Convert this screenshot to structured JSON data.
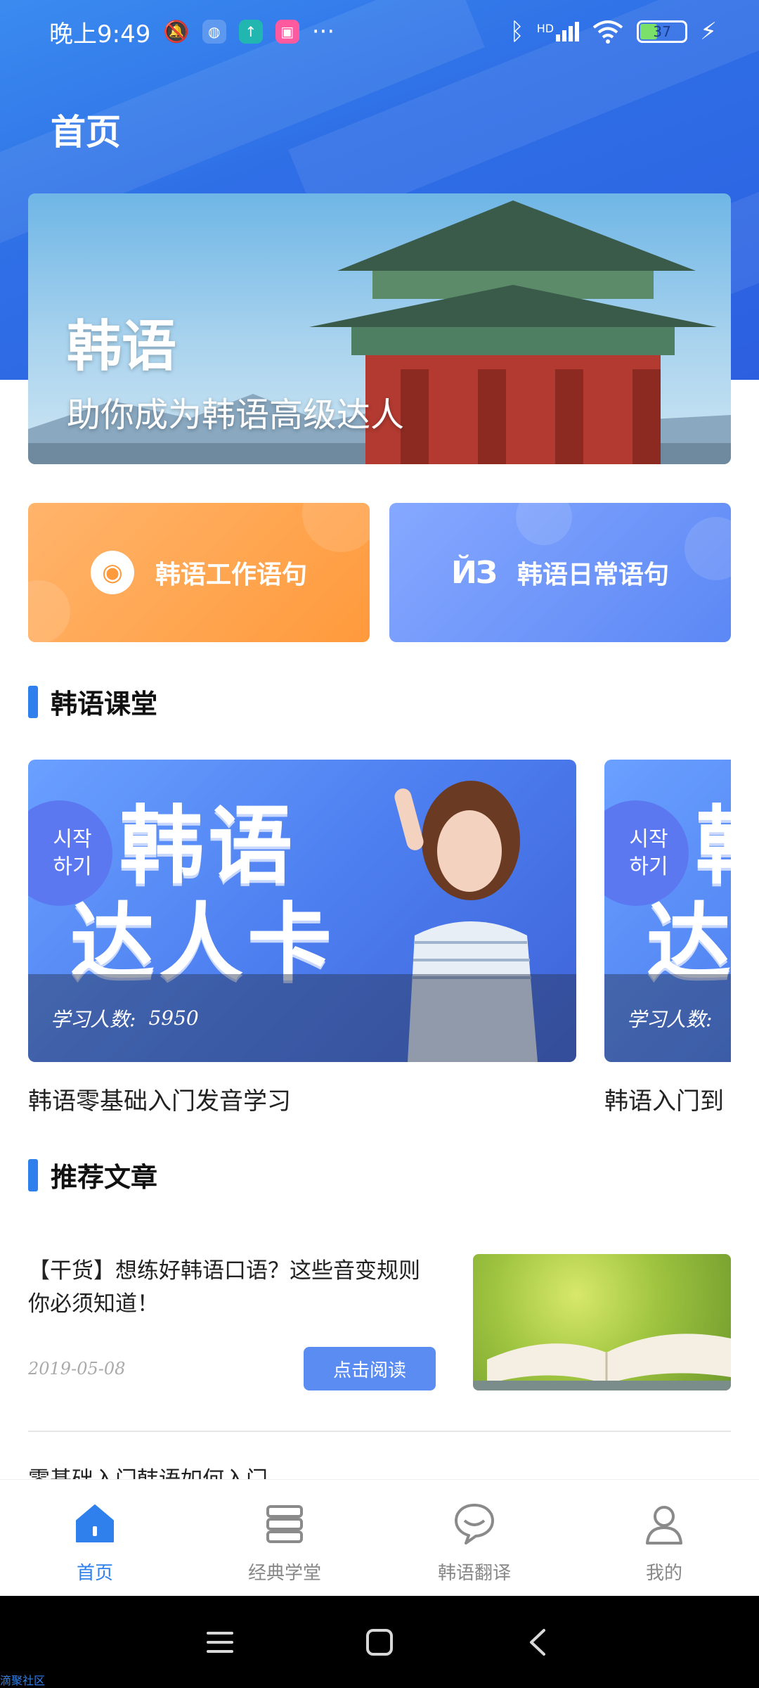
{
  "status_bar": {
    "time": "晚上9:49",
    "battery": "37",
    "more": "···",
    "network": "HD"
  },
  "header": {
    "title": "首页"
  },
  "banner": {
    "headline": "韩语",
    "subline": "助你成为韩语高级达人"
  },
  "quick_links": [
    {
      "label": "韩语工作语句",
      "icon": "lifebuoy-icon"
    },
    {
      "label": "韩语日常语句",
      "icon": "en-icon",
      "icon_text": "ЙЗ"
    }
  ],
  "sections": {
    "courses": "韩语课堂",
    "articles": "推荐文章"
  },
  "courses": [
    {
      "badge_line1": "시작",
      "badge_line2": "하기",
      "big_line1": "韩语",
      "big_line2": "达人卡",
      "learners_label": "学习人数:",
      "learners": "5950",
      "caption": "韩语零基础入门发音学习"
    },
    {
      "badge_line1": "시작",
      "badge_line2": "하기",
      "big_line1": "韩",
      "big_line2": "达",
      "learners_label": "学习人数:",
      "learners": "",
      "caption": "韩语入门到"
    }
  ],
  "articles": [
    {
      "title": "【干货】想练好韩语口语？这些音变规则你必须知道！",
      "date": "2019-05-08",
      "button": "点击阅读"
    },
    {
      "title": "零基础入门韩语如何入门"
    }
  ],
  "tabs": [
    {
      "label": "首页",
      "icon": "home-icon",
      "active": true
    },
    {
      "label": "经典学堂",
      "icon": "book-stack-icon",
      "active": false
    },
    {
      "label": "韩语翻译",
      "icon": "chat-bubble-icon",
      "active": false
    },
    {
      "label": "我的",
      "icon": "user-icon",
      "active": false
    }
  ],
  "watermark": "滴聚社区",
  "colors": {
    "primary": "#2f80ed",
    "orange": "#ff9a3c",
    "blue_card": "#5c88f5"
  }
}
